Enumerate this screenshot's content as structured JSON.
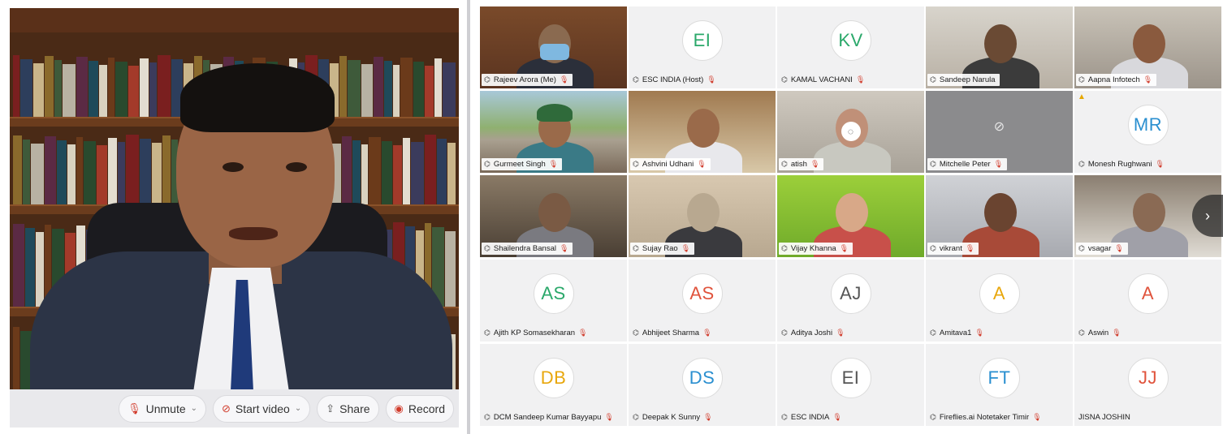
{
  "controls": {
    "unmute": "Unmute",
    "start_video": "Start video",
    "share": "Share",
    "record": "Record"
  },
  "grid": {
    "next_icon": "chevron-right-icon",
    "tiles": [
      {
        "name": "Rajeev Arora (Me)",
        "kind": "video",
        "muted": true
      },
      {
        "name": "ESC INDIA (Host)",
        "kind": "avatar",
        "initials": "EI",
        "color": "#2aa86a",
        "muted": true
      },
      {
        "name": "KAMAL VACHANI",
        "kind": "avatar",
        "initials": "KV",
        "color": "#2aa86a",
        "muted": true
      },
      {
        "name": "Sandeep Narula",
        "kind": "video",
        "muted": false,
        "active": true
      },
      {
        "name": "Aapna Infotech",
        "kind": "video",
        "muted": true
      },
      {
        "name": "Gurmeet Singh",
        "kind": "video",
        "muted": true
      },
      {
        "name": "Ashvini Udhani",
        "kind": "video",
        "muted": true
      },
      {
        "name": "atish",
        "kind": "video",
        "muted": true
      },
      {
        "name": "Mitchelle Peter",
        "kind": "camera-off",
        "muted": true
      },
      {
        "name": "Monesh Rughwani",
        "kind": "avatar",
        "initials": "MR",
        "color": "#2a8fd0",
        "muted": true
      },
      {
        "name": "Shailendra Bansal",
        "kind": "video",
        "muted": true
      },
      {
        "name": "Sujay Rao",
        "kind": "video",
        "muted": true
      },
      {
        "name": "Vijay Khanna",
        "kind": "video",
        "muted": true
      },
      {
        "name": "vikrant",
        "kind": "video",
        "muted": true
      },
      {
        "name": "vsagar",
        "kind": "video",
        "muted": true
      },
      {
        "name": "Ajith KP Somasekharan",
        "kind": "avatar",
        "initials": "AS",
        "color": "#2aa86a",
        "muted": true
      },
      {
        "name": "Abhijeet Sharma",
        "kind": "avatar",
        "initials": "AS",
        "color": "#e0533c",
        "muted": true
      },
      {
        "name": "Aditya Joshi",
        "kind": "avatar",
        "initials": "AJ",
        "color": "#555555",
        "muted": true
      },
      {
        "name": "Amitava1",
        "kind": "avatar",
        "initials": "A",
        "color": "#e8a70c",
        "muted": true
      },
      {
        "name": "Aswin",
        "kind": "avatar",
        "initials": "A",
        "color": "#e0533c",
        "muted": true
      },
      {
        "name": "DCM Sandeep Kumar Bayyapu",
        "kind": "avatar",
        "initials": "DB",
        "color": "#e8a70c",
        "muted": true
      },
      {
        "name": "Deepak K Sunny",
        "kind": "avatar",
        "initials": "DS",
        "color": "#2a8fd0",
        "muted": true
      },
      {
        "name": "ESC INDIA",
        "kind": "avatar",
        "initials": "EI",
        "color": "#555555",
        "muted": true
      },
      {
        "name": "Fireflies.ai Notetaker Timir",
        "kind": "avatar",
        "initials": "FT",
        "color": "#2a8fd0",
        "muted": true
      },
      {
        "name": "JISNA JOSHIN",
        "kind": "avatar",
        "initials": "JJ",
        "color": "#e0533c",
        "muted": false
      }
    ]
  }
}
